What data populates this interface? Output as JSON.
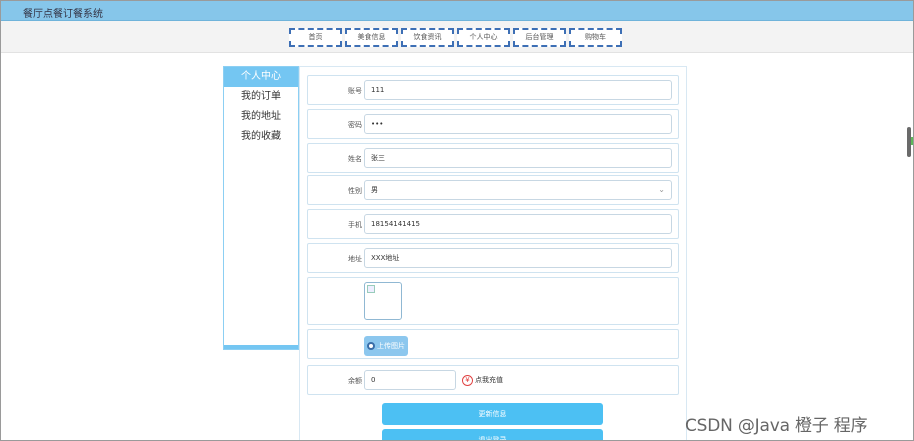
{
  "app": {
    "title": "餐厅点餐订餐系统"
  },
  "nav": {
    "items": [
      {
        "label": "首页"
      },
      {
        "label": "美食信息"
      },
      {
        "label": "饮食资讯"
      },
      {
        "label": "个人中心"
      },
      {
        "label": "后台管理"
      },
      {
        "label": "购物车"
      }
    ]
  },
  "sidebar": {
    "items": [
      {
        "label": "个人中心",
        "active": true
      },
      {
        "label": "我的订单"
      },
      {
        "label": "我的地址"
      },
      {
        "label": "我的收藏"
      }
    ]
  },
  "form": {
    "account": {
      "label": "账号",
      "value": "111"
    },
    "password": {
      "label": "密码",
      "value": "•••"
    },
    "name": {
      "label": "姓名",
      "value": "张三"
    },
    "gender": {
      "label": "性别",
      "value": "男"
    },
    "phone": {
      "label": "手机",
      "value": "18154141415"
    },
    "address": {
      "label": "地址",
      "value": "XXX地址"
    },
    "upload": {
      "label": "上传图片"
    },
    "balance": {
      "label": "余额",
      "value": "0",
      "recharge_label": "点我充值",
      "recharge_icon": "¥"
    }
  },
  "buttons": {
    "update": "更新信息",
    "logout": "退出登录"
  },
  "watermark": "CSDN @Java  橙子  程序",
  "colors": {
    "accent": "#4cc0f3",
    "titlebar": "#86c6ea",
    "nav_border": "#3d6fb5",
    "active": "#74c6f2"
  }
}
